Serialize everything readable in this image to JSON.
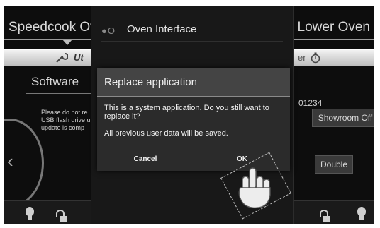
{
  "background_left": {
    "title": "Speedcook Ov",
    "utilities_fragment": "Ut",
    "software_label": "Software",
    "info_text_lines": [
      "Please do not re",
      "USB flash drive u",
      "update is comp"
    ]
  },
  "background_right": {
    "title": "Lower Oven",
    "bar_fragment": "er",
    "serial_fragment": "01234",
    "showroom_button": "Showroom Off",
    "double_button": "Double"
  },
  "app_chooser": {
    "icon_name": "oven-app-icon",
    "title": "Oven Interface"
  },
  "dialog": {
    "title": "Replace application",
    "message": "This is a system application. Do you still want to replace it?",
    "note": "All previous user data will be saved.",
    "cancel_label": "Cancel",
    "ok_label": "OK"
  },
  "overlay": {
    "icon_name": "hand-pointer-icon"
  },
  "colors": {
    "screen_bg": "#0d0d0d",
    "dialog_header": "#444444",
    "dialog_body": "#2b2b2b",
    "text_light": "#f0f0f0"
  }
}
